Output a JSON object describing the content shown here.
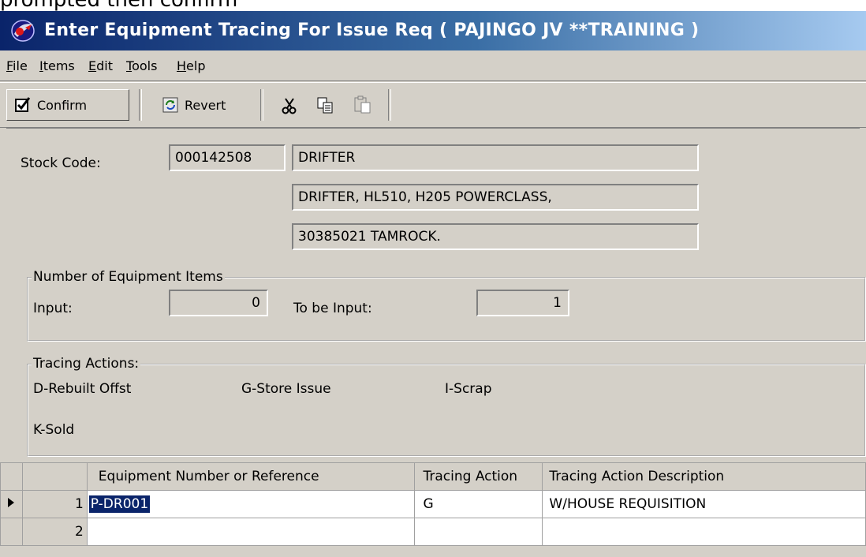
{
  "caption_above": "prompted then confirm",
  "window": {
    "title": "Enter Equipment Tracing For Issue Req ( PAJINGO JV  **TRAINING )",
    "icon": "app-logo-icon"
  },
  "menu": {
    "items": [
      {
        "label": "File"
      },
      {
        "label": "Items"
      },
      {
        "label": "Edit"
      },
      {
        "label": "Tools"
      },
      {
        "label": "Help"
      }
    ]
  },
  "toolbar": {
    "confirm_label": "Confirm",
    "confirm_icon": "checkbox-check-icon",
    "revert_label": "Revert",
    "revert_icon": "refresh-icon",
    "cut_icon": "scissors-icon",
    "copy_icon": "copy-icon",
    "paste_icon": "paste-icon"
  },
  "stock": {
    "label": "Stock Code:",
    "code": "000142508",
    "desc1": "DRIFTER",
    "desc2": "DRIFTER, HL510, H205 POWERCLASS,",
    "desc3": "30385021 TAMROCK."
  },
  "equipment_items": {
    "legend": "Number of Equipment Items",
    "input_label": "Input:",
    "input_value": "0",
    "to_be_label": "To be Input:",
    "to_be_value": "1"
  },
  "tracing_actions": {
    "legend": "Tracing Actions:",
    "actions": [
      "D-Rebuilt Offst",
      "G-Store Issue",
      "I-Scrap",
      "K-Sold"
    ]
  },
  "grid": {
    "headers": [
      "Equipment Number or Reference",
      "Tracing Action",
      "Tracing Action Description"
    ],
    "rows": [
      {
        "num": "1",
        "equipment": "P-DR001",
        "action": "G",
        "description": "W/HOUSE REQUISITION"
      },
      {
        "num": "2",
        "equipment": "",
        "action": "",
        "description": ""
      }
    ]
  },
  "colors": {
    "title_start": "#0a246a",
    "title_end": "#a6caf0",
    "window_bg": "#d4d0c8",
    "selection": "#0a246a"
  }
}
